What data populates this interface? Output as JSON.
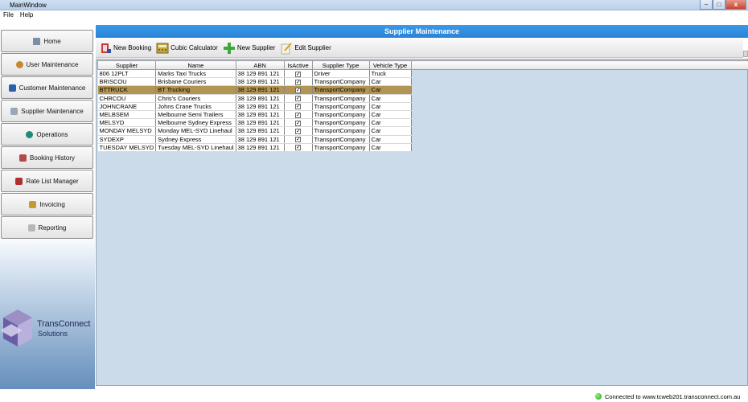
{
  "window": {
    "title": "MainWindow",
    "buttons": [
      "–",
      "□",
      "x"
    ]
  },
  "menu": [
    {
      "label": "File"
    },
    {
      "label": "Help"
    }
  ],
  "sidebar": {
    "items": [
      {
        "label": "Home",
        "icon": "home-icon",
        "color": "#7a8ea6"
      },
      {
        "label": "User Maintenance",
        "icon": "users-icon",
        "color": "#c9872d"
      },
      {
        "label": "Customer Maintenance",
        "icon": "customer-icon",
        "color": "#2b5fa8"
      },
      {
        "label": "Supplier Maintenance",
        "icon": "supplier-icon",
        "color": "#9aa7b8"
      },
      {
        "label": "Operations",
        "icon": "globe-icon",
        "color": "#1f8a7a"
      },
      {
        "label": "Booking History",
        "icon": "history-icon",
        "color": "#b34a4a"
      },
      {
        "label": "Rate List Manager",
        "icon": "rate-list-icon",
        "color": "#b03030"
      },
      {
        "label": "Invoicing",
        "icon": "invoice-icon",
        "color": "#c79a2f"
      },
      {
        "label": "Reporting",
        "icon": "report-icon",
        "color": "#b8b8b8"
      }
    ],
    "logo": {
      "line1": "TransConnect",
      "line2": "Solutions"
    }
  },
  "main": {
    "title": "Supplier Maintenance",
    "toolbar": [
      {
        "label": "New Booking",
        "icon": "new-booking-icon"
      },
      {
        "label": "Cubic Calculator",
        "icon": "calculator-icon"
      },
      {
        "label": "New Supplier",
        "icon": "add-icon"
      },
      {
        "label": "Edit Supplier",
        "icon": "edit-icon"
      }
    ],
    "columns": [
      "Supplier",
      "Name",
      "ABN",
      "IsActive",
      "Supplier Type",
      "Vehicle Type"
    ],
    "selected_row": 2,
    "rows": [
      {
        "supplier": "806 12PLT",
        "name": "Marks Taxi Trucks",
        "abn": "38 129 891 121",
        "active": true,
        "type": "Driver",
        "vehicle": "Truck"
      },
      {
        "supplier": "BRISCOU",
        "name": "Brisbane Couriers",
        "abn": "38 129 891 121",
        "active": true,
        "type": "TransportCompany",
        "vehicle": "Car"
      },
      {
        "supplier": "BTTRUCK",
        "name": "BT Trucking",
        "abn": "38 129 891 121",
        "active": true,
        "type": "TransportCompany",
        "vehicle": "Car"
      },
      {
        "supplier": "CHRCOU",
        "name": "Chris's Couriers",
        "abn": "38 129 891 121",
        "active": true,
        "type": "TransportCompany",
        "vehicle": "Car"
      },
      {
        "supplier": "JOHNCRANE",
        "name": "Johns Crane Trucks",
        "abn": "38 129 891 121",
        "active": true,
        "type": "TransportCompany",
        "vehicle": "Car"
      },
      {
        "supplier": "MELBSEM",
        "name": "Melbourne Semi Trailers",
        "abn": "38 129 891 121",
        "active": true,
        "type": "TransportCompany",
        "vehicle": "Car"
      },
      {
        "supplier": "MELSYD",
        "name": "Melbourne Sydney Express",
        "abn": "38 129 891 121",
        "active": true,
        "type": "TransportCompany",
        "vehicle": "Car"
      },
      {
        "supplier": "MONDAY MELSYD",
        "name": "Monday MEL-SYD Linehaul",
        "abn": "38 129 891 121",
        "active": true,
        "type": "TransportCompany",
        "vehicle": "Car"
      },
      {
        "supplier": "SYDEXP",
        "name": "Sydney Express",
        "abn": "38 129 891 121",
        "active": true,
        "type": "TransportCompany",
        "vehicle": "Car"
      },
      {
        "supplier": "TUESDAY MELSYD",
        "name": "Tuesday MEL-SYD Linehaul",
        "abn": "38 129 891 121",
        "active": true,
        "type": "TransportCompany",
        "vehicle": "Car"
      }
    ]
  },
  "status": {
    "text": "Connected to www.tcweb201.transconnect.com.au",
    "color": "#2aa51c"
  },
  "colors": {
    "header": "#2a84d6",
    "selected_row": "#b29552",
    "grid_bg": "#ccdbea"
  }
}
